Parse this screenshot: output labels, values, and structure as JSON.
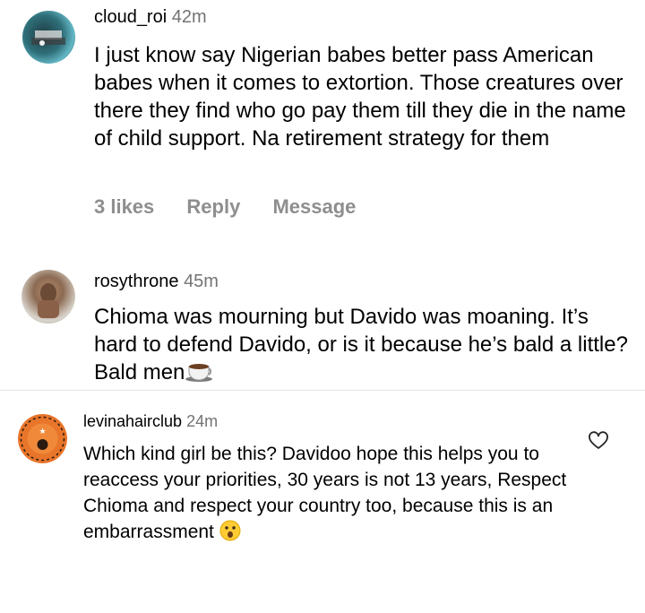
{
  "comments": [
    {
      "username": "cloud_roi",
      "time": "42m",
      "text": "I just know say Nigerian babes better pass American babes when it comes to extortion. Those creatures over there they find who go pay them till they die in the name of child support. Na retirement strategy for them",
      "likes": "3 likes",
      "reply": "Reply",
      "message": "Message"
    },
    {
      "username": "rosythrone",
      "time": "45m",
      "text": "Chioma was mourning but Davido was moaning. It’s hard to defend Davido, or is it because he’s bald a little? Bald men",
      "emoji": "coffee-cup-icon"
    },
    {
      "username": "levinahairclub",
      "time": "24m",
      "text": "Which kind girl be this? Davidoo hope this helps you to reaccess your priorities, 30 years is not 13 years, Respect Chioma and respect your country too, because this is an embarrassment",
      "emoji": "surprised-face-icon"
    }
  ],
  "colors": {
    "secondary_text": "#737373",
    "actions_text": "#8e8e8e",
    "divider": "#e4e4e4"
  }
}
